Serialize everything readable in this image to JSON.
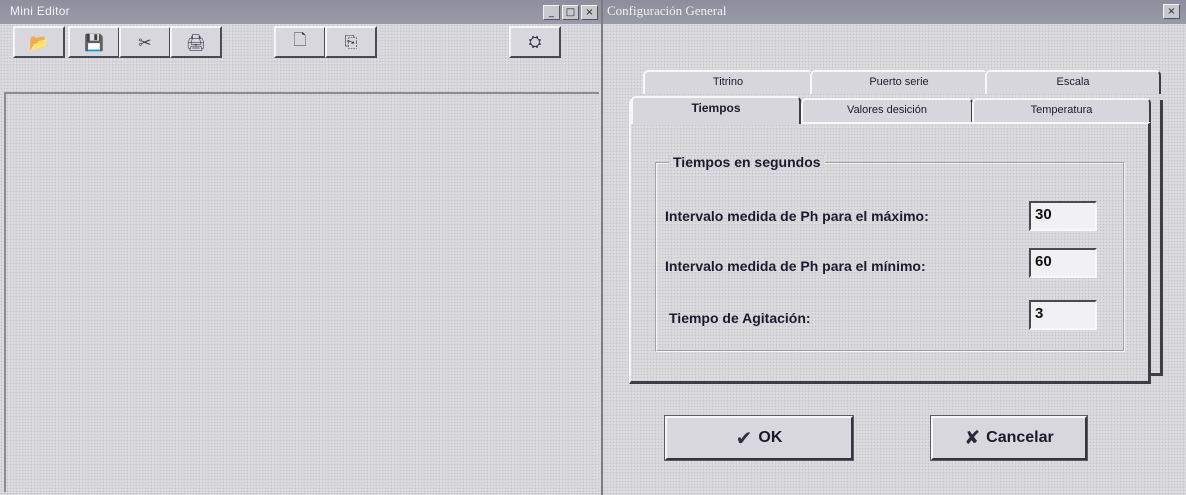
{
  "editor": {
    "title": "Mini Editor",
    "window_buttons": [
      "_",
      "□",
      "×"
    ],
    "toolbar": [
      {
        "name": "open-icon",
        "glyph": "📂"
      },
      {
        "name": "save-icon",
        "glyph": "💾"
      },
      {
        "name": "cut-icon",
        "glyph": "✂"
      },
      {
        "name": "print-icon",
        "glyph": "🖨"
      },
      {
        "name": "new-icon",
        "glyph": "🗋"
      },
      {
        "name": "copy-icon",
        "glyph": "⎘"
      },
      {
        "name": "help-icon",
        "glyph": "⛭"
      }
    ]
  },
  "dialog": {
    "title": "Configuración General",
    "close": "×",
    "tabs_back": [
      "Titrino",
      "Puerto serie",
      "Escala"
    ],
    "tabs_front": [
      "Tiempos",
      "Valores desición",
      "Temperatura"
    ],
    "active_tab": "Tiempos",
    "group_title": "Tiempos en segundos",
    "fields": [
      {
        "label": "Intervalo medida de Ph para el máximo:",
        "value": "30"
      },
      {
        "label": "Intervalo medida de Ph para el mínimo:",
        "value": "60"
      },
      {
        "label": "Tiempo de Agitación:",
        "value": "3"
      }
    ],
    "ok_label": "OK",
    "ok_icon": "✔",
    "cancel_label": "Cancelar",
    "cancel_icon": "✘"
  }
}
